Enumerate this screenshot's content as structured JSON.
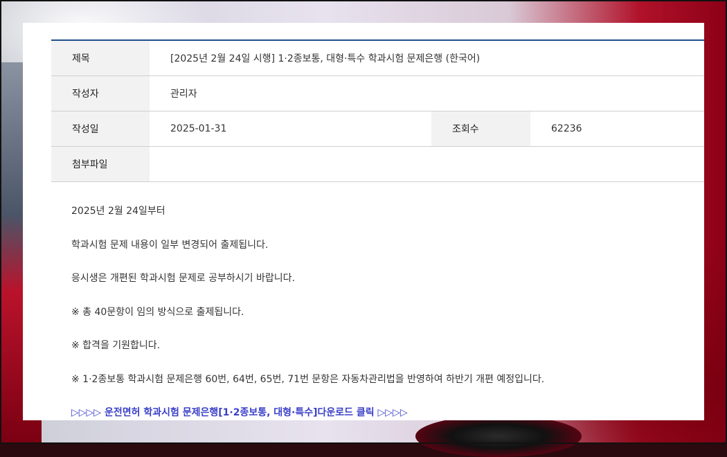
{
  "post": {
    "title_label": "제목",
    "title_value": "[2025년 2월 24일 시행] 1·2종보통, 대형·특수 학과시험 문제은행 (한국어)",
    "author_label": "작성자",
    "author_value": "관리자",
    "date_label": "작성일",
    "date_value": "2025-01-31",
    "views_label": "조회수",
    "views_value": "62236",
    "attachment_label": "첨부파일",
    "attachment_value": ""
  },
  "content": {
    "paragraphs": [
      "2025년 2월 24일부터",
      "학과시험 문제 내용이 일부 변경되어 출제됩니다.",
      "응시생은 개편된 학과시험 문제로 공부하시기 바랍니다.",
      "※ 총 40문항이 임의 방식으로 출제됩니다.",
      "※ 합격을 기원합니다.",
      "※ 1·2종보통 학과시험 문제은행 60번, 64번, 65번, 71번 문항은 자동차관리법을 반영하여 하반기 개편 예정입니다."
    ],
    "download_link": "▷▷▷▷ 운전면허 학과시험 문제은행[1·2종보통, 대형·특수]다운로드 클릭 ▷▷▷▷"
  },
  "colors": {
    "accent_line": "#1f4e8c",
    "link": "#3a3fc8"
  }
}
